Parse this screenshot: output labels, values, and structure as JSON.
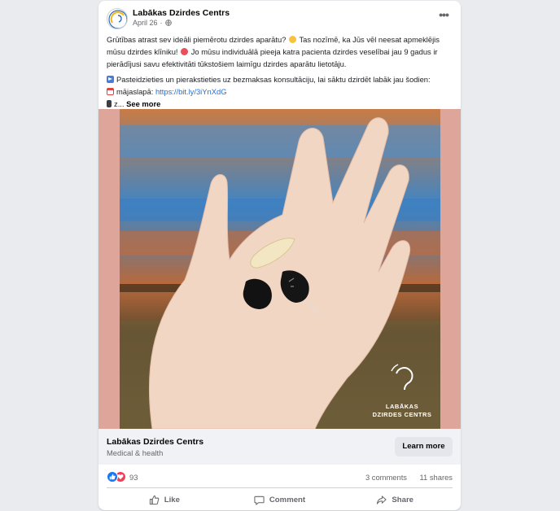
{
  "post": {
    "page_name": "Labākas Dzirdes Centrs",
    "date": "April 26",
    "separator": "·",
    "text_line1": "Grūtības atrast sev ideāli piemērotu dzirdes aparātu? ",
    "text_line1b": " Tas nozīmē, ka Jūs vēl neesat apmeklējis mūsu dzirdes klīniku! ",
    "text_line1c": " Jo mūsu individuālā pieeja katra pacienta dzirdes veselībai jau 9 gadus ir pierādījusi savu efektivitāti tūkstošiem laimīgu dzirdes aparātu lietotāju.",
    "text_line2": "Pasteidzieties un pierakstieties uz bezmaksas konsultāciju, lai sāktu dzirdēt labāk jau šodien:",
    "website_label": "mājaslapā: ",
    "website_url": "https://bit.ly/3iYnXdG",
    "truncated": "z... ",
    "see_more": "See more"
  },
  "image": {
    "logo_line1": "LABĀKAS",
    "logo_line2": "DZIRDES CENTRS"
  },
  "link_preview": {
    "title": "Labākas Dzirdes Centrs",
    "subtitle": "Medical & health",
    "cta": "Learn more"
  },
  "stats": {
    "reaction_count": "93",
    "comments": "3 comments",
    "shares": "11 shares"
  },
  "actions": {
    "like": "Like",
    "comment": "Comment",
    "share": "Share"
  },
  "icons": {
    "globe": "globe-icon",
    "more": "more-options-icon",
    "like": "thumbs-up-icon",
    "comment": "comment-bubble-icon",
    "share": "share-arrow-icon"
  },
  "colors": {
    "accent": "#1877f2",
    "love": "#f33e58",
    "link": "#216fdb",
    "image_border": "#dea59b"
  }
}
